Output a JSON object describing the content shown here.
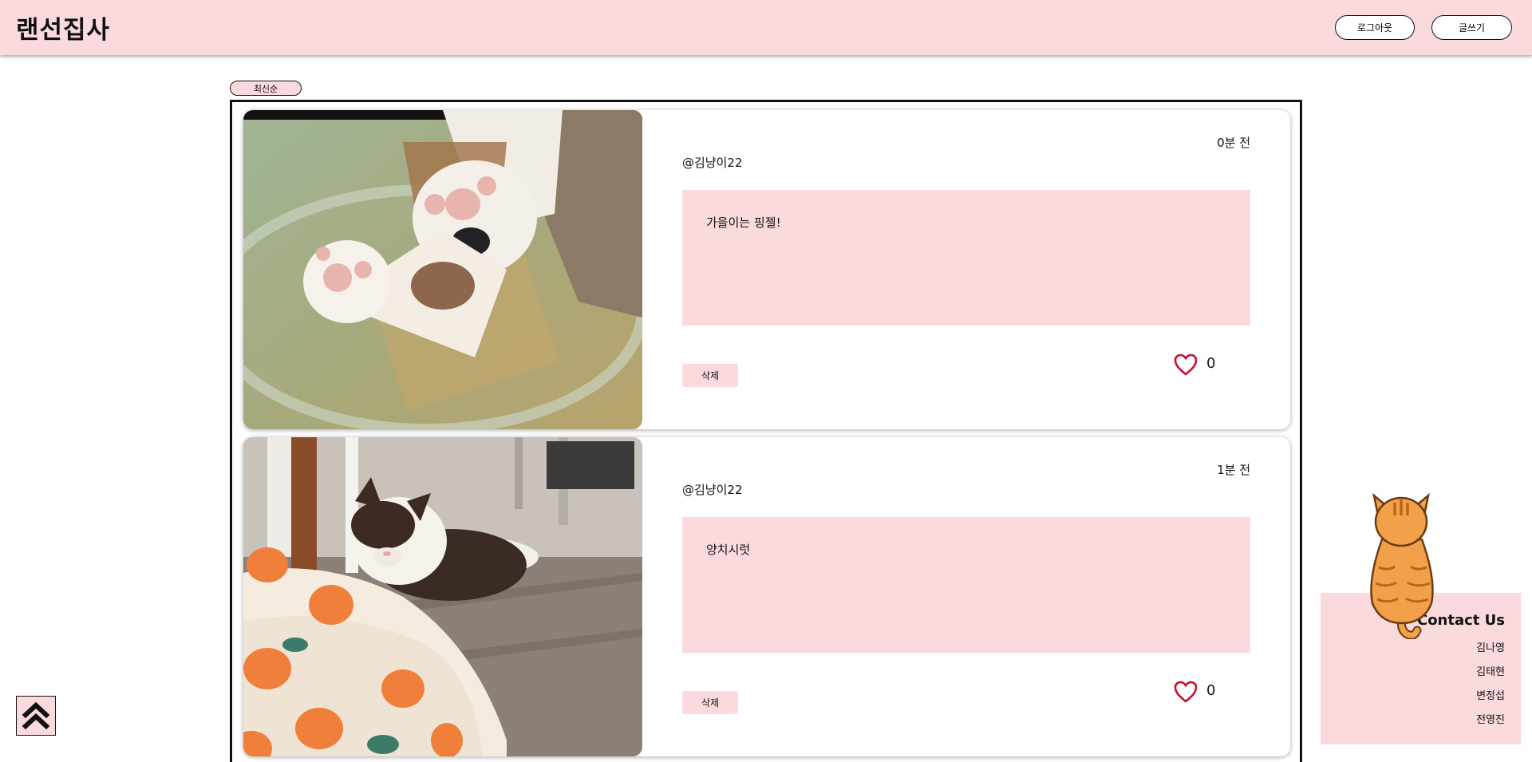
{
  "header": {
    "logo": "랜선집사",
    "logout_label": "로그아웃",
    "write_label": "글쓰기",
    "background": "#fadadd"
  },
  "sort": {
    "label": "최신순"
  },
  "posts": [
    {
      "author": "@김냥이22",
      "time": "0분 전",
      "content": "가을이는 핑젤!",
      "delete_label": "삭제",
      "likes": "0",
      "image": "cat-paws-photo"
    },
    {
      "author": "@김냥이22",
      "time": "1분 전",
      "content": "양치시럿",
      "delete_label": "삭제",
      "likes": "0",
      "image": "cat-lying-photo"
    }
  ],
  "contact": {
    "title": "Contact Us",
    "names": [
      "김나영",
      "김태현",
      "변정섭",
      "전영진"
    ]
  },
  "icons": {
    "like": "heart-outline-icon",
    "scroll_top": "double-chevron-up-icon",
    "mascot": "orange-cat-back-illustration"
  },
  "colors": {
    "accent": "#fadadd",
    "heart": "#c8102e"
  }
}
